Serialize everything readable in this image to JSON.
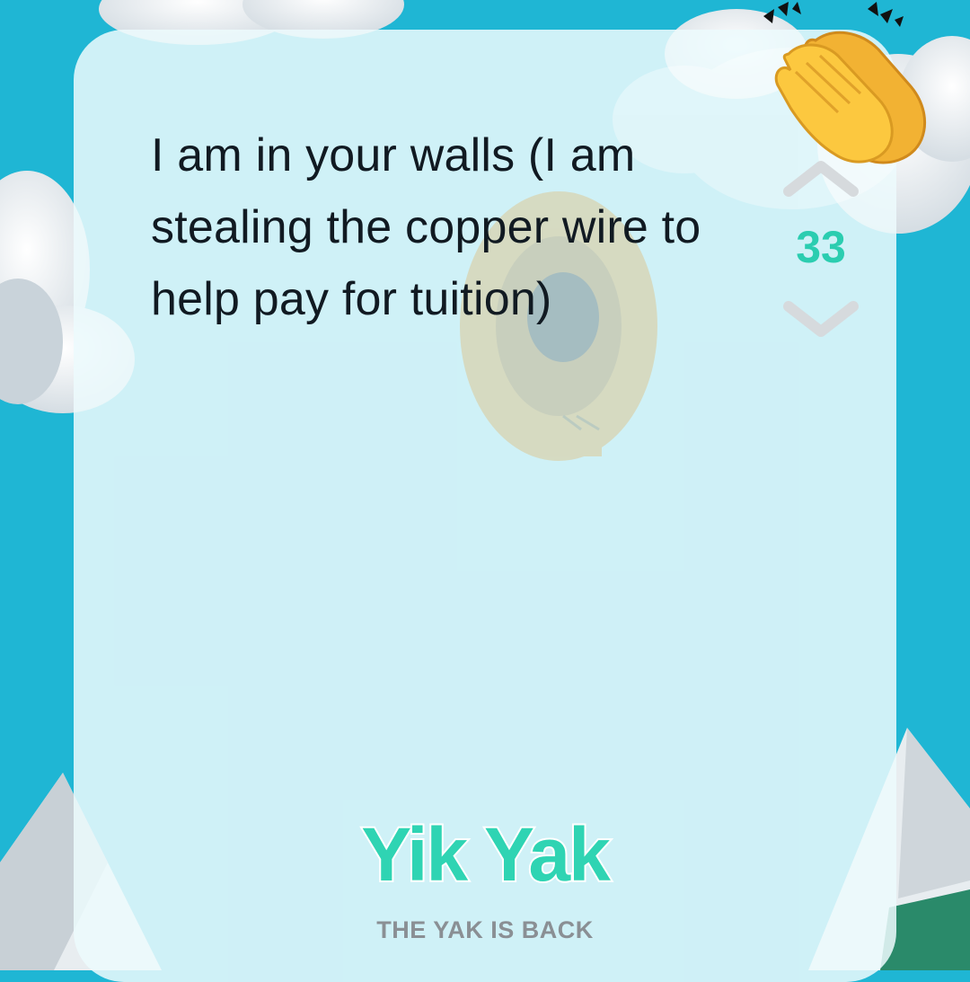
{
  "post": {
    "text": "I am in your walls (I am stealing the copper wire to help pay for tuition)"
  },
  "vote": {
    "count": "33",
    "upvote_icon": "chevron-up-icon",
    "downvote_icon": "chevron-down-icon"
  },
  "brand": {
    "logo": "Yik Yak",
    "tagline": "THE YAK IS BACK"
  },
  "decoration": {
    "emoji": "clapping-hands-icon",
    "background": "sky-clouds-mountains"
  },
  "colors": {
    "sky": "#1fb6d4",
    "card": "#ecfafd",
    "text": "#111a22",
    "accent": "#2bcdb0",
    "logo": "#2fd4b3",
    "tagline": "#8a8f94",
    "chevron": "#d6dadd"
  }
}
